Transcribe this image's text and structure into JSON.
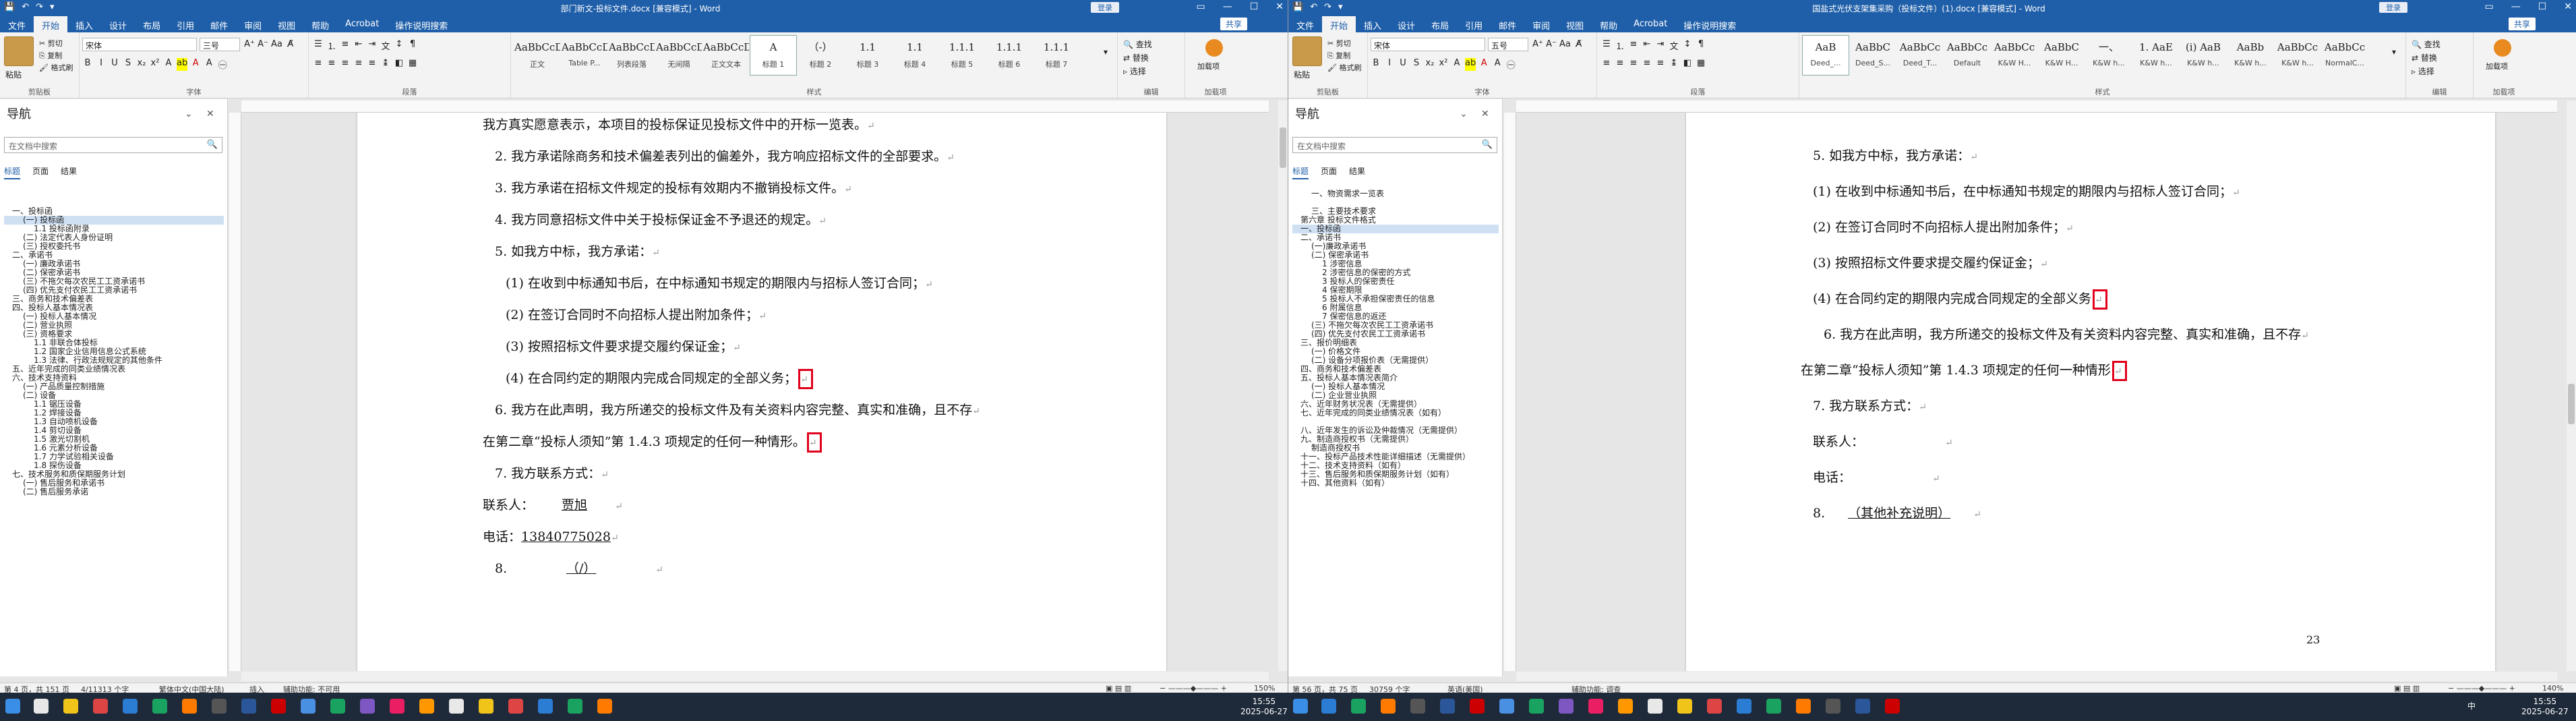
{
  "panes": [
    {
      "title": "部门新文-投标文件.docx [兼容模式] - Word",
      "account": "登录",
      "tabs": [
        "文件",
        "开始",
        "插入",
        "设计",
        "布局",
        "引用",
        "邮件",
        "审阅",
        "视图",
        "帮助",
        "Acrobat",
        "操作说明搜索"
      ],
      "share": "共享",
      "groups": {
        "clipboard": "剪贴板",
        "font": "字体",
        "paragraph": "段落",
        "styles": "样式",
        "editing": "编辑",
        "addin": "加载项"
      },
      "clipboard": {
        "paste": "粘贴",
        "cut": "剪切",
        "copy": "复制",
        "format": "格式刷"
      },
      "font_name": "宋体",
      "font_size": "三号",
      "styles": [
        {
          "sample": "AaBbCcDd",
          "name": "正文"
        },
        {
          "sample": "AaBbCcDc",
          "name": "Table P..."
        },
        {
          "sample": "AaBbCcDd",
          "name": "列表段落"
        },
        {
          "sample": "AaBbCcDd",
          "name": "无间隔"
        },
        {
          "sample": "AaBbCcDd",
          "name": "正文文本"
        },
        {
          "sample": "A",
          "name": "标题 1"
        },
        {
          "sample": "（-）",
          "name": "标题 2"
        },
        {
          "sample": "1.1",
          "name": "标题 3"
        },
        {
          "sample": "1.1",
          "name": "标题 4"
        },
        {
          "sample": "1.1.1",
          "name": "标题 5"
        },
        {
          "sample": "1.1.1",
          "name": "标题 6"
        },
        {
          "sample": "1.1.1",
          "name": "标题 7"
        }
      ],
      "editing": [
        "查找",
        "替换",
        "选择"
      ],
      "addin": "加载项",
      "nav": {
        "title": "导航",
        "search_placeholder": "在文档中搜索",
        "tabs": [
          "标题",
          "页面",
          "结果"
        ],
        "items": [
          {
            "text": "一、投标函",
            "ind": 0
          },
          {
            "text": "(一) 投标函",
            "ind": 1,
            "sel": true
          },
          {
            "text": "1.1 投标函附录",
            "ind": 2
          },
          {
            "text": "(二) 法定代表人身份证明",
            "ind": 1
          },
          {
            "text": "(三) 授权委托书",
            "ind": 1
          },
          {
            "text": "二、承诺书",
            "ind": 0
          },
          {
            "text": "(一) 廉政承诺书",
            "ind": 1
          },
          {
            "text": "(二) 保密承诺书",
            "ind": 1
          },
          {
            "text": "(三) 不拖欠每次农民工工资承诺书",
            "ind": 1
          },
          {
            "text": "(四) 优先支付农民工工资承诺书",
            "ind": 1
          },
          {
            "text": "三、商务和技术偏差表",
            "ind": 0
          },
          {
            "text": "四、投标人基本情况表",
            "ind": 0
          },
          {
            "text": "(一) 投标人基本情况",
            "ind": 1
          },
          {
            "text": "(二) 营业执照",
            "ind": 1
          },
          {
            "text": "(三) 资格要求",
            "ind": 1
          },
          {
            "text": "1.1 非联合体投标",
            "ind": 2
          },
          {
            "text": "1.2 国家企业信用信息公式系统",
            "ind": 2
          },
          {
            "text": "1.3 法律、行政法规规定的其他条件",
            "ind": 2
          },
          {
            "text": "五、近年完成的同类业绩情况表",
            "ind": 0
          },
          {
            "text": "六、技术支持资料",
            "ind": 0
          },
          {
            "text": "(一) 产品质量控制措施",
            "ind": 1
          },
          {
            "text": "(二) 设备",
            "ind": 1
          },
          {
            "text": "1.1 锯压设备",
            "ind": 2
          },
          {
            "text": "1.2 焊接设备",
            "ind": 2
          },
          {
            "text": "1.3 自动喷机设备",
            "ind": 2
          },
          {
            "text": "1.4 剪切设备",
            "ind": 2
          },
          {
            "text": "1.5 激光切割机",
            "ind": 2
          },
          {
            "text": "1.6 元素分析设备",
            "ind": 2
          },
          {
            "text": "1.7 力学试验相关设备",
            "ind": 2
          },
          {
            "text": "1.8 探伤设备",
            "ind": 2
          },
          {
            "text": "七、技术服务和质保期服务计划",
            "ind": 0
          },
          {
            "text": "(一) 售后服务和承诺书",
            "ind": 1
          },
          {
            "text": "(二) 售后服务承诺",
            "ind": 1
          }
        ]
      },
      "doc": [
        {
          "t": "我方真实愿意表示，本项目的投标保证见投标文件中的开标一览表。",
          "x": 0
        },
        {
          "t": "2. 我方承诺除商务和技术偏差表列出的偏差外，我方响应招标文件的全部要求。",
          "x": 18
        },
        {
          "t": "3. 我方承诺在招标文件规定的投标有效期内不撤销投标文件。",
          "x": 18
        },
        {
          "t": "4. 我方同意招标文件中关于投标保证金不予退还的规定。",
          "x": 18
        },
        {
          "t": "5. 如我方中标，我方承诺：",
          "x": 18
        },
        {
          "t": "(1) 在收到中标通知书后，在中标通知书规定的期限内与招标人签订合同；",
          "x": 34
        },
        {
          "t": "(2) 在签订合同时不向招标人提出附加条件；",
          "x": 34
        },
        {
          "t": "(3) 按照招标文件要求提交履约保证金；",
          "x": 34
        },
        {
          "t": "(4) 在合同约定的期限内完成合同规定的全部义务；",
          "x": 34
        },
        {
          "t": "6. 我方在此声明，我方所递交的投标文件及有关资料内容完整、真实和准确，且不存",
          "x": 18
        },
        {
          "t": "在第二章“投标人须知”第 1.4.3 项规定的任何一种情形。",
          "x": 0
        },
        {
          "t": "7. 我方联系方式：",
          "x": 18
        },
        {
          "t": "联系人：",
          "x": 0,
          "fill": "贾旭"
        },
        {
          "t": "电话：",
          "x": 0,
          "fill": "13840775028"
        },
        {
          "t": "8.",
          "x": 18,
          "fill": "（/）"
        }
      ],
      "status": {
        "page": "第 4 页，共 151 页",
        "words": "4/11313 个字",
        "lang": "繁体中文(中国大陆)",
        "mode": "插入",
        "acc": "辅助功能: 不可用",
        "zoom": "150%"
      }
    },
    {
      "title": "国盐式光伏支架集采购（投标文件）(1).docx [兼容模式] - Word",
      "account": "登录",
      "tabs": [
        "文件",
        "开始",
        "插入",
        "设计",
        "布局",
        "引用",
        "邮件",
        "审阅",
        "视图",
        "帮助",
        "Acrobat",
        "操作说明搜索"
      ],
      "share": "共享",
      "groups": {
        "clipboard": "剪贴板",
        "font": "字体",
        "paragraph": "段落",
        "styles": "样式",
        "editing": "编辑",
        "addin": "加载项"
      },
      "clipboard": {
        "paste": "粘贴",
        "cut": "剪切",
        "copy": "复制",
        "format": "格式刷"
      },
      "font_name": "宋体",
      "font_size": "五号",
      "styles": [
        {
          "sample": "AaB",
          "name": "Deed_..."
        },
        {
          "sample": "AaBbC",
          "name": "Deed_S..."
        },
        {
          "sample": "AaBbCc",
          "name": "Deed_T..."
        },
        {
          "sample": "AaBbCc",
          "name": "Default"
        },
        {
          "sample": "AaBbCc",
          "name": "K&W H..."
        },
        {
          "sample": "AaBbC",
          "name": "K&W H..."
        },
        {
          "sample": "一、",
          "name": "K&W h..."
        },
        {
          "sample": "1. AaE",
          "name": "K&W h..."
        },
        {
          "sample": "(i) AaB",
          "name": "K&W h..."
        },
        {
          "sample": "AaBb",
          "name": "K&W h..."
        },
        {
          "sample": "AaBbCc",
          "name": "K&W h..."
        },
        {
          "sample": "AaBbCc",
          "name": "NormalC..."
        }
      ],
      "editing": [
        "查找",
        "替换",
        "选择"
      ],
      "addin": "加载项",
      "nav": {
        "title": "导航",
        "search_placeholder": "在文档中搜索",
        "tabs": [
          "标题",
          "页面",
          "结果"
        ],
        "items": [
          {
            "text": "一、物资需求一览表",
            "ind": 1
          },
          {
            "text": "",
            "ind": 0
          },
          {
            "text": "三、主要技术要求",
            "ind": 1
          },
          {
            "text": "第六章 投标文件格式",
            "ind": 0
          },
          {
            "text": "一、投标函",
            "ind": 0,
            "sel": true
          },
          {
            "text": "二、承诺书",
            "ind": 0
          },
          {
            "text": "(一)廉政承诺书",
            "ind": 1
          },
          {
            "text": "(二) 保密承诺书",
            "ind": 1
          },
          {
            "text": "1 涉密信息",
            "ind": 2
          },
          {
            "text": "2 涉密信息的保密的方式",
            "ind": 2
          },
          {
            "text": "3 投标人的保密责任",
            "ind": 2
          },
          {
            "text": "4 保密期限",
            "ind": 2
          },
          {
            "text": "5 投标人不承担保密责任的信息",
            "ind": 2
          },
          {
            "text": "6 附属信息",
            "ind": 2
          },
          {
            "text": "7 保密信息的返还",
            "ind": 2
          },
          {
            "text": "(三) 不拖欠每次农民工工资承诺书",
            "ind": 1
          },
          {
            "text": "(四) 优先支付农民工工资承诺书",
            "ind": 1
          },
          {
            "text": "三、报价明细表",
            "ind": 0
          },
          {
            "text": "(一) 价格文件",
            "ind": 1
          },
          {
            "text": "(二) 设备分项报价表（无需提供）",
            "ind": 1
          },
          {
            "text": "四、商务和技术偏差表",
            "ind": 0
          },
          {
            "text": "五、投标人基本情况表简介",
            "ind": 0
          },
          {
            "text": "(一) 投标人基本情况",
            "ind": 1
          },
          {
            "text": "(二) 企业营业执照",
            "ind": 1
          },
          {
            "text": "六、近年财务状况表（无需提供）",
            "ind": 0
          },
          {
            "text": "七、近年完成的同类业绩情况表（如有）",
            "ind": 0
          },
          {
            "text": "",
            "ind": 0
          },
          {
            "text": "八、近年发生的诉讼及仲裁情况（无需提供）",
            "ind": 0
          },
          {
            "text": "九、制造商授权书（无需提供）",
            "ind": 0
          },
          {
            "text": "制造商授权书",
            "ind": 1
          },
          {
            "text": "十一、投标产品技术性能详细描述（无需提供）",
            "ind": 0
          },
          {
            "text": "十二、技术支持资料（如有）",
            "ind": 0
          },
          {
            "text": "十三、售后服务和质保期服务计划（如有）",
            "ind": 0
          },
          {
            "text": "十四、其他资料（如有）",
            "ind": 0
          }
        ]
      },
      "doc": [
        {
          "t": "5. 如我方中标，我方承诺：",
          "x": 18
        },
        {
          "t": "(1) 在收到中标通知书后，在中标通知书规定的期限内与招标人签订合同；",
          "x": 18
        },
        {
          "t": "(2) 在签订合同时不向招标人提出附加条件；",
          "x": 18
        },
        {
          "t": "(3) 按照招标文件要求提交履约保证金；",
          "x": 18
        },
        {
          "t": "(4) 在合同约定的期限内完成合同规定的全部义务",
          "x": 18
        },
        {
          "t": "6. 我方在此声明，我方所递交的投标文件及有关资料内容完整、真实和准确，且不存",
          "x": 34
        },
        {
          "t": "在第二章“投标人须知”第 1.4.3 项规定的任何一种情形",
          "x": 0
        },
        {
          "t": "7. 我方联系方式：",
          "x": 18
        },
        {
          "t": "联系人：",
          "x": 18,
          "fill": ""
        },
        {
          "t": "电话：",
          "x": 18,
          "fill": ""
        },
        {
          "t": "8.",
          "x": 18,
          "fill": "（其他补充说明）"
        }
      ],
      "page_number": "23",
      "status": {
        "page": "第 56 页，共 75 页",
        "words": "30759 个字",
        "lang": "英语(美国)",
        "mode": "",
        "acc": "辅助功能: 调查",
        "zoom": "140%"
      }
    }
  ],
  "taskbar": {
    "clock_left": {
      "time": "15:55",
      "date": "2025-06-27"
    },
    "clock_right": {
      "time": "15:55",
      "date": "2025-06-27"
    },
    "lang": "中"
  }
}
